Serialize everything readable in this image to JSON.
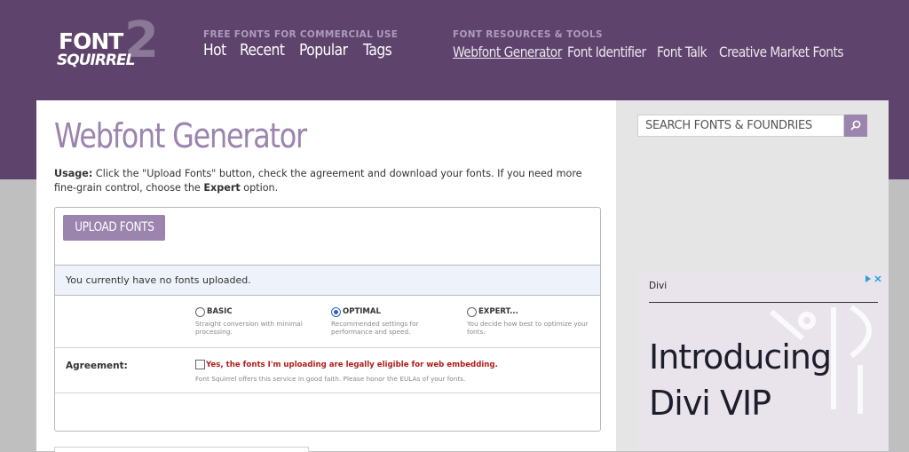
{
  "logo": {
    "word1": "FONT",
    "word2": "SQUIRREL",
    "badge": "2"
  },
  "nav": {
    "free_label": "FREE FONTS FOR COMMERCIAL USE",
    "free_links": [
      "Hot",
      "Recent",
      "Popular",
      "Tags"
    ],
    "resources_label": "FONT RESOURCES & TOOLS",
    "resource_links": [
      "Webfont Generator",
      "Font Identifier",
      "Font Talk",
      "Creative Market Fonts"
    ]
  },
  "page": {
    "title": "Webfont Generator",
    "usage_label": "Usage:",
    "usage_text_1": " Click the \"Upload Fonts\" button, check the agreement and download your fonts. If you need more fine-grain control, choose the ",
    "usage_expert": "Expert",
    "usage_text_2": " option."
  },
  "generator": {
    "upload_label": "UPLOAD FONTS",
    "upload_icon": "arrow-up-icon",
    "status": "You currently have no fonts uploaded.",
    "options": [
      {
        "name": "BASIC",
        "desc": "Straight conversion with minimal processing.",
        "selected": false
      },
      {
        "name": "OPTIMAL",
        "desc": "Recommended settings for performance and speed.",
        "selected": true
      },
      {
        "name": "EXPERT...",
        "desc": "You decide how best to optimize your fonts.",
        "selected": false
      }
    ],
    "agreement_label": "Agreement:",
    "agreement_text": "Yes, the fonts I'm uploading are legally eligible for web embedding.",
    "agreement_note": "Font Squirrel offers this service in good faith. Please honor the EULAs of your fonts.",
    "agreement_checked": false
  },
  "sidebar": {
    "search_placeholder": "SEARCH FONTS & FOUNDRIES",
    "search_icon": "search-icon",
    "ad": {
      "brand": "Divi",
      "headline_1": "Introducing",
      "headline_2": "Divi VIP"
    }
  },
  "colors": {
    "header_bg": "#5e436c",
    "accent": "#9b84ad",
    "nav_label": "#ad9cbb",
    "warning": "#b31b1b",
    "radio_selected": "#2b63c4"
  }
}
